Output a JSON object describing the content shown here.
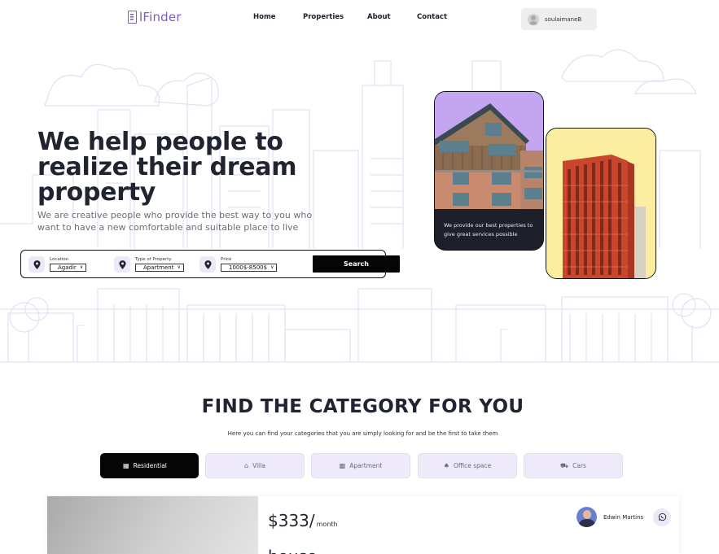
{
  "nav": {
    "brand": "lFinder",
    "links": [
      "Home",
      "Properties",
      "About",
      "Contact"
    ],
    "user": "soulaimaneB"
  },
  "hero": {
    "title": "We help people to realize their dream property",
    "subtitle": "We are creative people who provide the best way to you who want to have a new comfortable and suitable place to live",
    "card_text": "We provide our best properties to give great services possible"
  },
  "search": {
    "location_label": "Location",
    "location_value": "Agadir",
    "type_label": "Type of Property",
    "type_value": "Apartment",
    "price_label": "Price",
    "price_value": "1000$-8500$",
    "button": "Search"
  },
  "category": {
    "title": "FIND THE CATEGORY FOR YOU",
    "subtitle": "Here you can find your categories that you are simply looking for and be the first to take them",
    "tabs": [
      {
        "label": "Residential",
        "icon": "building-icon",
        "active": true
      },
      {
        "label": "Villa",
        "icon": "villa-icon",
        "active": false
      },
      {
        "label": "Apartment",
        "icon": "apartment-icon",
        "active": false
      },
      {
        "label": "Office space",
        "icon": "office-chair-icon",
        "active": false
      },
      {
        "label": "Cars",
        "icon": "car-icon",
        "active": false
      }
    ]
  },
  "listing": {
    "price": "$333/",
    "per": "month",
    "title": "house",
    "agent": "Edwin Martins"
  },
  "colors": {
    "brand": "#7a5cc4",
    "dark": "#1f2430",
    "tab_idle": "#eeeaf9",
    "card_purple": "#c4a6f0",
    "card_yellow": "#fbeea0"
  }
}
